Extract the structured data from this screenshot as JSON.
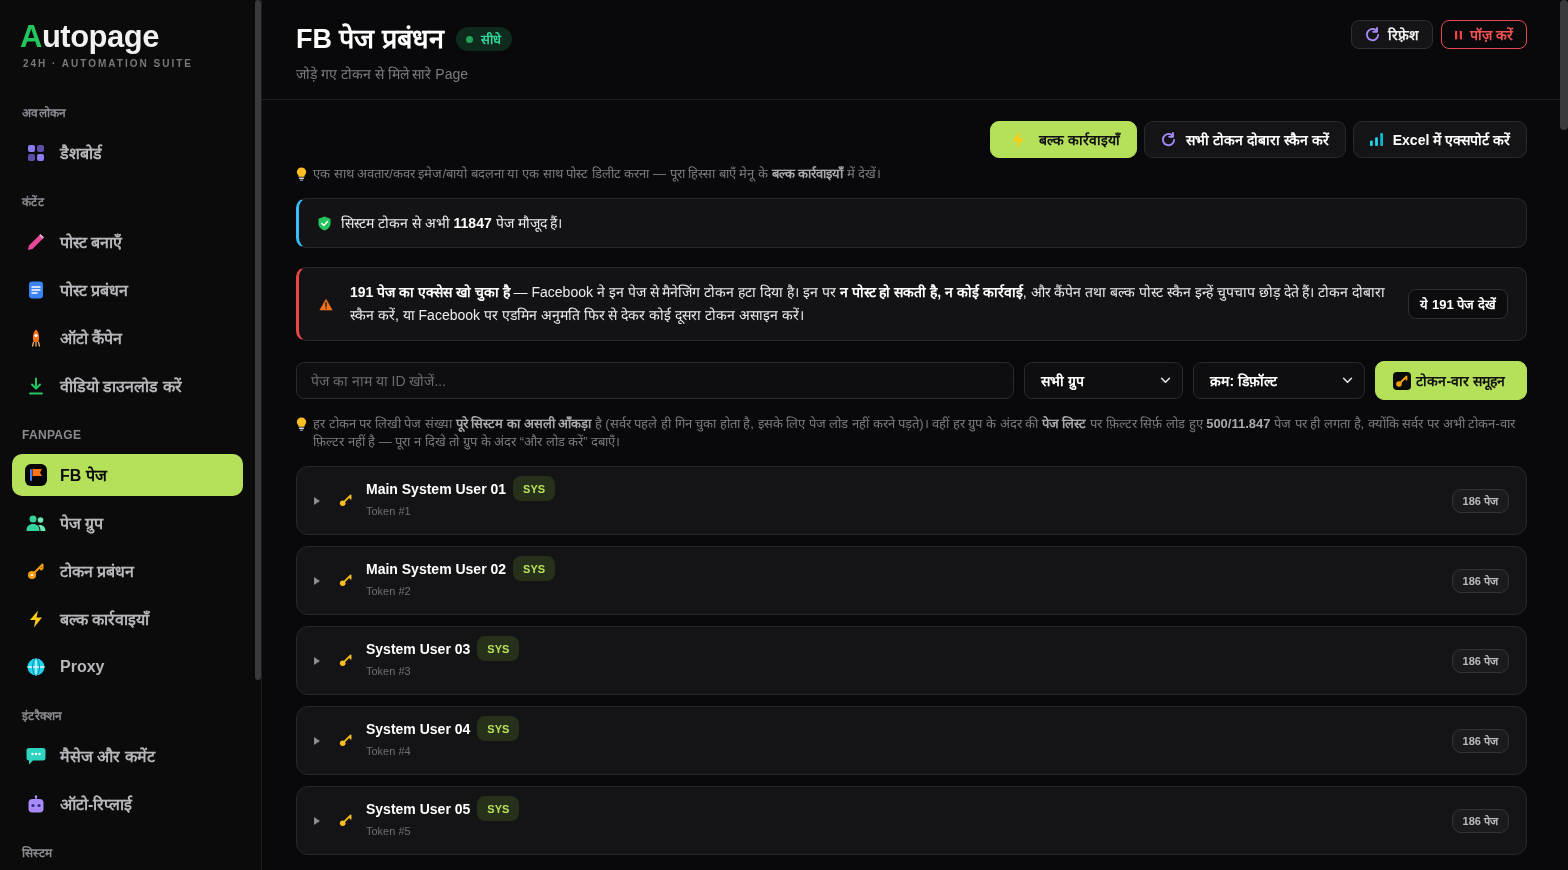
{
  "sidebar": {
    "logo": "Autopage",
    "tagline": "24H · AUTOMATION SUITE",
    "sections": [
      {
        "title": "अवलोकन",
        "items": [
          {
            "label": "डैशबोर्ड",
            "selected": false
          }
        ]
      },
      {
        "title": "कंटेंट",
        "items": [
          {
            "label": "पोस्ट बनाएँ",
            "selected": false
          },
          {
            "label": "पोस्ट प्रबंधन",
            "selected": false
          },
          {
            "label": "ऑटो कैंपेन",
            "selected": false
          },
          {
            "label": "वीडियो डाउनलोड करें",
            "selected": false
          }
        ]
      },
      {
        "title": "FANPAGE",
        "items": [
          {
            "label": "FB पेज",
            "selected": true
          },
          {
            "label": "पेज ग्रुप",
            "selected": false
          },
          {
            "label": "टोकन प्रबंधन",
            "selected": false
          },
          {
            "label": "बल्क कार्रवाइयाँ",
            "selected": false
          },
          {
            "label": "Proxy",
            "selected": false
          }
        ]
      },
      {
        "title": "इंटरैक्शन",
        "items": [
          {
            "label": "मैसेज और कमेंट",
            "selected": false
          },
          {
            "label": "ऑटो-रिप्लाई",
            "selected": false
          }
        ]
      },
      {
        "title": "सिस्टम"
      }
    ]
  },
  "header": {
    "title": "FB पेज प्रबंधन",
    "badge": "सीधे",
    "subtitle": "जोड़े गए टोकन से मिले सारे Page",
    "buttons": [
      {
        "label": "रिफ़्रेश",
        "kind": "default"
      },
      {
        "label": "पॉज़ करें",
        "kind": "danger"
      }
    ]
  },
  "toolbar": {
    "buttons": [
      {
        "label": "बल्क कार्रवाइयाँ",
        "kind": "primary"
      },
      {
        "label": "सभी टोकन दोबारा स्कैन करें",
        "kind": "default"
      },
      {
        "label": "Excel में एक्सपोर्ट करें",
        "kind": "default"
      }
    ],
    "hint": "एक साथ अवतार/कवर इमेज/बायो बदलना या एक साथ पोस्ट डिलीट करना — पूरा हिस्सा बाएँ मेनू के **बल्क कार्रवाइयाँ** में देखें।"
  },
  "notices": [
    {
      "kind": "info",
      "text": "सिस्टम टोकन से अभी **11847** पेज मौजूद हैं।"
    },
    {
      "kind": "warning",
      "text": "**191 पेज का एक्सेस खो चुका है** — Facebook ने इन पेज से मैनेजिंग टोकन हटा दिया है। इन पर **न पोस्ट हो सकती है, न कोई कार्रवाई**, और कैंपेन तथा बल्क पोस्ट स्कैन इन्हें चुपचाप छोड़ देते हैं। टोकन दोबारा स्कैन करें, या Facebook पर एडमिन अनुमति फिर से देकर कोई दूसरा टोकन असाइन करें।",
      "button": "ये 191 पेज देखें"
    }
  ],
  "filters": {
    "search": {
      "placeholder": "पेज का नाम या ID खोजें..."
    },
    "group": {
      "value": "सभी ग्रुप"
    },
    "sort": {
      "value": "क्रम: डिफ़ॉल्ट"
    },
    "group_button": {
      "label": "टोकन-वार समूहन",
      "kind": "primary"
    },
    "hint": "हर टोकन पर लिखी पेज संख्या **पूरे सिस्टम का असली आँकड़ा** है (सर्वर पहले ही गिन चुका होता है, इसके लिए पेज लोड नहीं करने पड़ते)। वहीं हर ग्रुप के अंदर की **पेज लिस्ट** पर फ़िल्टर सिर्फ़ लोड हुए **500/11.847** पेज पर ही लगता है, क्योंकि सर्वर पर अभी टोकन-वार फ़िल्टर नहीं है — पूरा न दिखे तो ग्रुप के अंदर “और लोड करें” दबाएँ।"
  },
  "tokens": [
    {
      "name": "Main System User 01",
      "badge": "SYS",
      "subtitle": "Token #1",
      "count": "186 पेज",
      "expanded": false
    },
    {
      "name": "Main System User 02",
      "badge": "SYS",
      "subtitle": "Token #2",
      "count": "186 पेज",
      "expanded": false
    },
    {
      "name": "System User 03",
      "badge": "SYS",
      "subtitle": "Token #3",
      "count": "186 पेज",
      "expanded": false
    },
    {
      "name": "System User 04",
      "badge": "SYS",
      "subtitle": "Token #4",
      "count": "186 पेज",
      "expanded": false
    },
    {
      "name": "System User 05",
      "badge": "SYS",
      "subtitle": "Token #5",
      "count": "186 पेज",
      "expanded": false
    }
  ]
}
